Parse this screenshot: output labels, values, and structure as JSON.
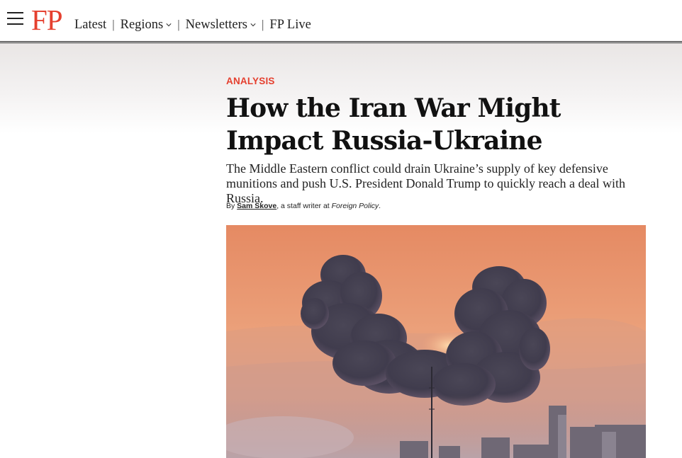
{
  "header": {
    "logo": "FP",
    "nav": [
      {
        "label": "Latest",
        "dropdown": false
      },
      {
        "label": "Regions",
        "dropdown": true
      },
      {
        "label": "Newsletters",
        "dropdown": true
      },
      {
        "label": "FP Live",
        "dropdown": false
      }
    ],
    "separator": "|"
  },
  "article": {
    "kicker": "ANALYSIS",
    "headline": "How the Iran War Might Impact Russia-Ukraine",
    "dek": "The Middle Eastern conflict could drain Ukraine’s supply of key defensive munitions and push U.S. President Donald Trump to quickly reach a deal with Russia.",
    "byline": {
      "prefix": "By ",
      "author": "Sam Skove",
      "role": ", a staff writer at ",
      "publication": "Foreign Policy",
      "suffix": "."
    }
  },
  "colors": {
    "brand_red": "#e5402f",
    "text": "#111111",
    "sky_orange": "#e8996e",
    "smoke": "#3f3d4c"
  },
  "icons": {
    "menu": "hamburger-icon",
    "dropdown": "chevron-down-icon"
  }
}
